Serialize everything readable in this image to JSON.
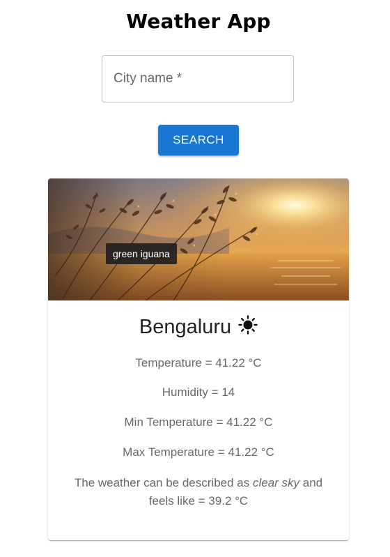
{
  "header": {
    "title": "Weather App"
  },
  "search": {
    "placeholder": "City name *",
    "value": "",
    "button_label": "SEARCH"
  },
  "card": {
    "image_tooltip": "green iguana",
    "city": "Bengaluru",
    "weather_icon": "sun-icon",
    "temperature": "Temperature = 41.22 °C",
    "humidity": "Humidity = 14",
    "min_temperature": "Min Temperature = 41.22 °C",
    "max_temperature": "Max Temperature = 41.22 °C",
    "description_prefix": "The weather can be described as ",
    "description_condition": "clear sky",
    "description_suffix": " and feels like = 39.2 °C"
  },
  "colors": {
    "primary": "#1976d2",
    "field_border": "#c4c4c4",
    "text_secondary": "rgba(0,0,0,0.6)"
  }
}
